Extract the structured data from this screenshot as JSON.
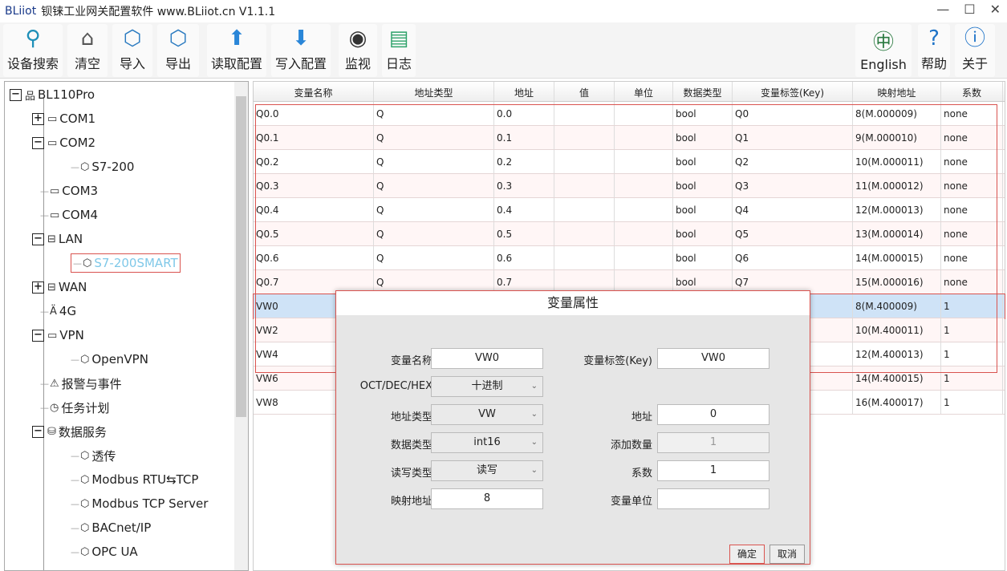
{
  "title": {
    "brand": "BLiiot",
    "text": "钡铼工业网关配置软件 www.BLiiot.cn V1.1.1"
  },
  "window_controls": [
    "—",
    "☐",
    "✕"
  ],
  "toolbar": [
    {
      "label": "设备搜索",
      "icon": "search-icon",
      "glyph": "⚲",
      "color": "#1e8fb8"
    },
    {
      "label": "清空",
      "icon": "broom-icon",
      "glyph": "⌂",
      "color": "#555"
    },
    {
      "label": "导入",
      "icon": "import-box-icon",
      "glyph": "⬡",
      "color": "#2a7ac0"
    },
    {
      "label": "导出",
      "icon": "export-box-icon",
      "glyph": "⬡",
      "color": "#2a7ac0"
    },
    {
      "label": "读取配置",
      "icon": "upload-icon",
      "glyph": "⬆",
      "color": "#2a86d8"
    },
    {
      "label": "写入配置",
      "icon": "download-icon",
      "glyph": "⬇",
      "color": "#2a86d8"
    },
    {
      "label": "监视",
      "icon": "eye-icon",
      "glyph": "◉",
      "color": "#333"
    },
    {
      "label": "日志",
      "icon": "log-file-icon",
      "glyph": "▤",
      "color": "#2fa36b"
    },
    {
      "label": "English",
      "icon": "translate-icon",
      "glyph": "㊥",
      "color": "#2a7a40"
    },
    {
      "label": "帮助",
      "icon": "help-icon",
      "glyph": "?",
      "color": "#1e73c8"
    },
    {
      "label": "关于",
      "icon": "info-icon",
      "glyph": "ⓘ",
      "color": "#1e73c8"
    }
  ],
  "tree": [
    {
      "label": "BL110Pro",
      "level": 0,
      "exp": "−",
      "icon": "network-icon",
      "glyph": "品"
    },
    {
      "label": "COM1",
      "level": 1,
      "exp": "+",
      "icon": "serial-port-icon",
      "glyph": "▭"
    },
    {
      "label": "COM2",
      "level": 1,
      "exp": "−",
      "icon": "serial-port-icon",
      "glyph": "▭"
    },
    {
      "label": "S7-200",
      "level": 2,
      "icon": "device-cube-icon",
      "glyph": "⬡"
    },
    {
      "label": "COM3",
      "level": 1,
      "icon": "serial-port-icon",
      "glyph": "▭"
    },
    {
      "label": "COM4",
      "level": 1,
      "icon": "serial-port-icon",
      "glyph": "▭"
    },
    {
      "label": "LAN",
      "level": 1,
      "exp": "−",
      "icon": "ethernet-icon",
      "glyph": "⊟"
    },
    {
      "label": "S7-200SMART",
      "level": 2,
      "icon": "device-cube-icon",
      "glyph": "⬡",
      "selected": true
    },
    {
      "label": "WAN",
      "level": 1,
      "exp": "+",
      "icon": "ethernet-icon",
      "glyph": "⊟"
    },
    {
      "label": "4G",
      "level": 1,
      "icon": "antenna-icon",
      "glyph": "Ä"
    },
    {
      "label": "VPN",
      "level": 1,
      "exp": "−",
      "icon": "vpn-icon",
      "glyph": "▭"
    },
    {
      "label": "OpenVPN",
      "level": 2,
      "icon": "device-cube-icon",
      "glyph": "⬡"
    },
    {
      "label": "报警与事件",
      "level": 1,
      "icon": "alarm-icon",
      "glyph": "⚠"
    },
    {
      "label": "任务计划",
      "level": 1,
      "icon": "schedule-icon",
      "glyph": "◷"
    },
    {
      "label": "数据服务",
      "level": 1,
      "exp": "−",
      "icon": "database-icon",
      "glyph": "⛁"
    },
    {
      "label": "透传",
      "level": 2,
      "icon": "device-cube-icon",
      "glyph": "⬡"
    },
    {
      "label": "Modbus RTU⇆TCP",
      "level": 2,
      "icon": "device-cube-icon",
      "glyph": "⬡"
    },
    {
      "label": "Modbus TCP Server",
      "level": 2,
      "icon": "device-cube-icon",
      "glyph": "⬡"
    },
    {
      "label": "BACnet/IP",
      "level": 2,
      "icon": "device-cube-icon",
      "glyph": "⬡"
    },
    {
      "label": "OPC UA",
      "level": 2,
      "icon": "device-cube-icon",
      "glyph": "⬡"
    }
  ],
  "table": {
    "columns": [
      "变量名称",
      "地址类型",
      "地址",
      "值",
      "单位",
      "数据类型",
      "变量标签(Key)",
      "映射地址",
      "系数"
    ],
    "rows": [
      [
        "Q0.0",
        "Q",
        "0.0",
        "",
        "",
        "bool",
        "Q0",
        "8(M.000009)",
        "none"
      ],
      [
        "Q0.1",
        "Q",
        "0.1",
        "",
        "",
        "bool",
        "Q1",
        "9(M.000010)",
        "none"
      ],
      [
        "Q0.2",
        "Q",
        "0.2",
        "",
        "",
        "bool",
        "Q2",
        "10(M.000011)",
        "none"
      ],
      [
        "Q0.3",
        "Q",
        "0.3",
        "",
        "",
        "bool",
        "Q3",
        "11(M.000012)",
        "none"
      ],
      [
        "Q0.4",
        "Q",
        "0.4",
        "",
        "",
        "bool",
        "Q4",
        "12(M.000013)",
        "none"
      ],
      [
        "Q0.5",
        "Q",
        "0.5",
        "",
        "",
        "bool",
        "Q5",
        "13(M.000014)",
        "none"
      ],
      [
        "Q0.6",
        "Q",
        "0.6",
        "",
        "",
        "bool",
        "Q6",
        "14(M.000015)",
        "none"
      ],
      [
        "Q0.7",
        "Q",
        "0.7",
        "",
        "",
        "bool",
        "Q7",
        "15(M.000016)",
        "none"
      ],
      [
        "VW0",
        "VW",
        "0",
        "",
        "",
        "int16",
        "VW0",
        "8(M.400009)",
        "1"
      ],
      [
        "VW2",
        "",
        "",
        "",
        "",
        "",
        "",
        "10(M.400011)",
        "1"
      ],
      [
        "VW4",
        "",
        "",
        "",
        "",
        "",
        "",
        "12(M.400013)",
        "1"
      ],
      [
        "VW6",
        "",
        "",
        "",
        "",
        "",
        "",
        "14(M.400015)",
        "1"
      ],
      [
        "VW8",
        "",
        "",
        "",
        "",
        "",
        "",
        "16(M.400017)",
        "1"
      ]
    ],
    "selected_row": 8
  },
  "dialog": {
    "title": "变量属性",
    "name_label": "变量名称",
    "name_value": "VW0",
    "key_label": "变量标签(Key)",
    "key_value": "VW0",
    "radix_label": "OCT/DEC/HEX",
    "radix_value": "十进制",
    "addr_type_label": "地址类型",
    "addr_type_value": "VW",
    "addr_label": "地址",
    "addr_value": "0",
    "dtype_label": "数据类型",
    "dtype_value": "int16",
    "count_label": "添加数量",
    "count_value": "1",
    "rw_label": "读写类型",
    "rw_value": "读写",
    "factor_label": "系数",
    "factor_value": "1",
    "map_label": "映射地址",
    "map_value": "8",
    "unit_label": "变量单位",
    "unit_value": "",
    "ok": "确定",
    "cancel": "取消"
  },
  "colors": {
    "highlight": "#d9534f",
    "selected_row": "#cfe3f7",
    "selected_tree": "#7fc8e8"
  }
}
